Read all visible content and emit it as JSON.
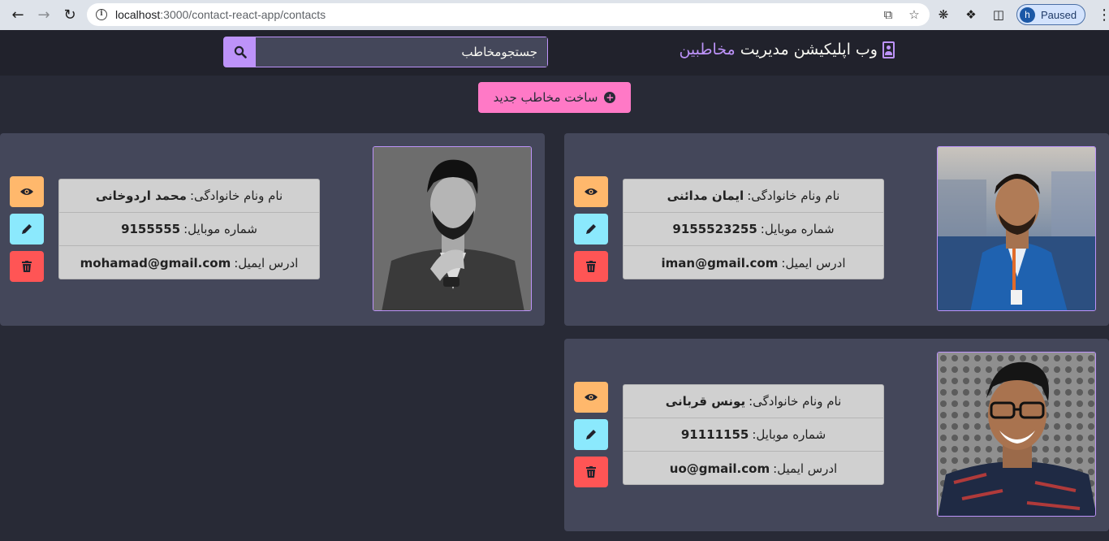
{
  "browser": {
    "url_host": "localhost",
    "url_path": ":3000/contact-react-app/contacts",
    "profile_initial": "h",
    "profile_status": "Paused"
  },
  "app": {
    "brand_text": "وب اپلیکیشن مدیریت",
    "brand_accent": "مخاطبین",
    "search_placeholder": "جستجومخاطب",
    "new_contact_label": "ساخت مخاطب جدید",
    "colors": {
      "background": "#282a36",
      "navbar": "#21222c",
      "card": "#44475a",
      "purple": "#bd93f9",
      "pink": "#ff79c6",
      "orange": "#ffb86c",
      "cyan": "#8be9fd",
      "red": "#ff5555"
    }
  },
  "labels": {
    "fullname": "نام ونام خانوادگی:",
    "mobile": "شماره موبایل:",
    "email": "ادرس ایمیل:"
  },
  "contacts": [
    {
      "fullname": "ایمان مدائنی",
      "mobile": "9155523255",
      "email": "iman@gmail.com",
      "photo": "man-blue-suit-photo"
    },
    {
      "fullname": "محمد اردوخانی",
      "mobile": "9155555",
      "email": "mohamad@gmail.com",
      "photo": "man-grey-suit-photo"
    },
    {
      "fullname": "یونس قربانی",
      "mobile": "91111155",
      "email": "uo@gmail.com",
      "photo": "man-glasses-photo"
    }
  ]
}
